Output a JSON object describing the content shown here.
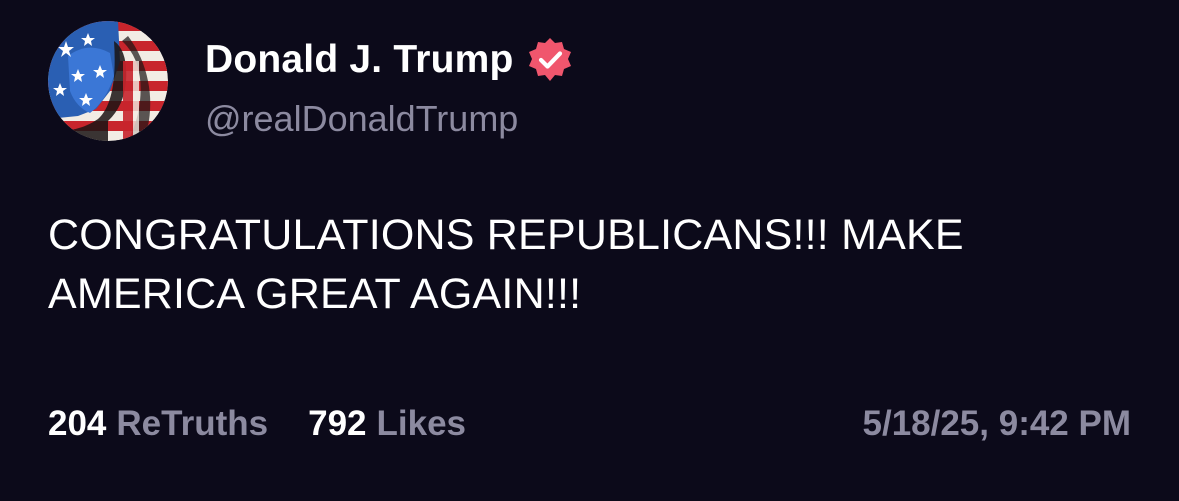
{
  "post": {
    "author": {
      "display_name": "Donald J. Trump",
      "handle": "@realDonaldTrump",
      "verified": true,
      "verified_icon": "verified-badge-icon",
      "verified_color": "#f0566d",
      "avatar_icon": "american-flag-portrait-avatar"
    },
    "text": "CONGRATULATIONS REPUBLICANS!!! MAKE AMERICA GREAT AGAIN!!!",
    "stats": {
      "retruths_count": "204",
      "retruths_label": "ReTruths",
      "likes_count": "792",
      "likes_label": "Likes"
    },
    "timestamp": "5/18/25, 9:42 PM"
  },
  "colors": {
    "background": "#0c0a1a",
    "primary_text": "#ffffff",
    "secondary_text": "#8c8aa0"
  }
}
